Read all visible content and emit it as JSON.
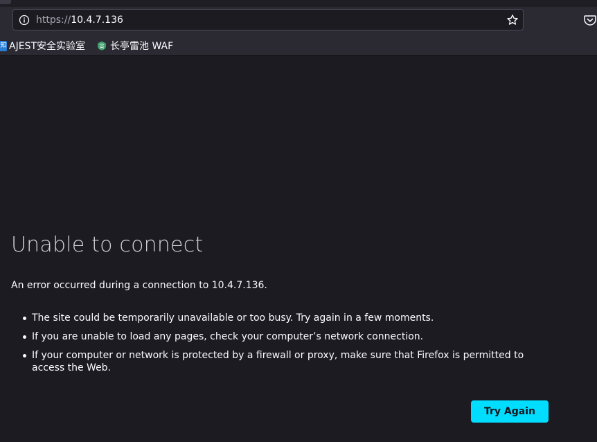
{
  "urlbar": {
    "scheme": "https://",
    "host": "10.4.7.136"
  },
  "bookmarks": [
    {
      "label": "AJEST安全实验室",
      "icon": "ajest-favicon",
      "icon_text": "知"
    },
    {
      "label": "长亭雷池 WAF",
      "icon": "safeline-favicon"
    }
  ],
  "error": {
    "title": "Unable to connect",
    "description": "An error occurred during a connection to 10.4.7.136.",
    "items": [
      "The site could be temporarily unavailable or too busy. Try again in a few moments.",
      "If you are unable to load any pages, check your computer’s network connection.",
      "If your computer or network is protected by a firewall or proxy, make sure that Firefox is permitted to access the Web."
    ],
    "button_label": "Try Again"
  },
  "colors": {
    "page_background": "#1c1b22",
    "toolbar_background": "#2b2a33",
    "button_accent": "#00ddff"
  }
}
